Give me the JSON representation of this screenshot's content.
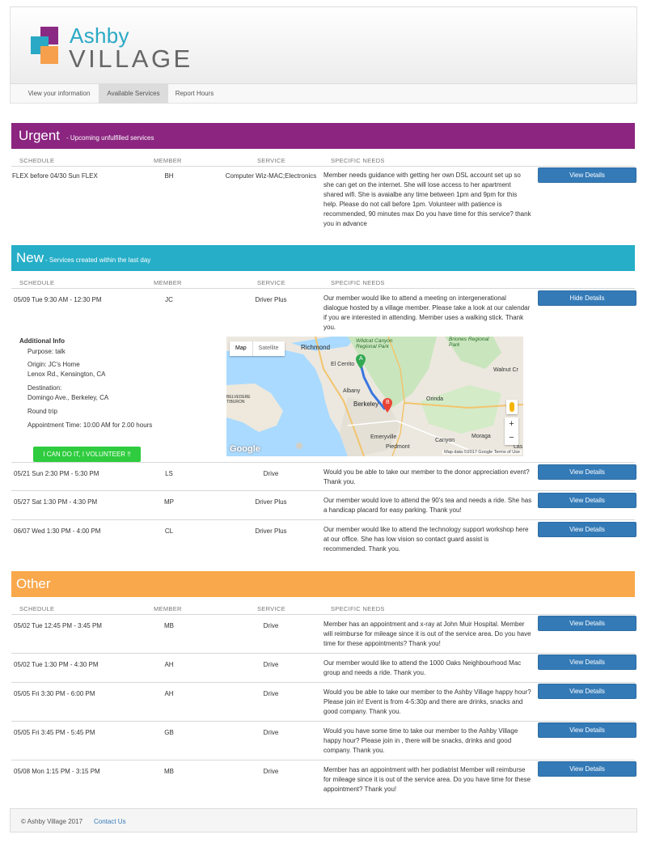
{
  "brand": {
    "line1": "Ashby",
    "line2": "VILLAGE"
  },
  "nav": {
    "tabs": [
      {
        "label": "View your information"
      },
      {
        "label": "Available Services"
      },
      {
        "label": "Report Hours"
      }
    ]
  },
  "columns": {
    "schedule": "SCHEDULE",
    "member": "MEMBER",
    "service": "SERVICE",
    "needs": "SPECIFIC NEEDS"
  },
  "urgent": {
    "title": "Urgent",
    "subtitle": " - Upcoming unfulfilled services",
    "rows": [
      {
        "schedule": "FLEX before 04/30 Sun  FLEX",
        "member": "BH",
        "service": "Computer Wiz-MAC;Electronics",
        "needs": "Member needs guidance with getting her own DSL account set up so she can get on the internet. She will lose access to her apartment shared wifi. She is avaialbe any time between 1pm and 9pm for this help. Please do not call before 1pm. Volunteer with patience is recommended, 90 minutes max Do you have time for this service? thank you in advance",
        "button": "View Details"
      }
    ]
  },
  "new": {
    "title": "New",
    "subtitle": " - Services created within the last day",
    "rows": [
      {
        "schedule": "05/09 Tue  9:30 AM - 12:30 PM",
        "member": "JC",
        "service": "Driver Plus",
        "needs": "Our member would like to attend a meeting on intergenerational dialogue hosted by a village member. Please take a look at our calendar if you are interested in attending. Member uses a walking stick. Thank you.",
        "button": "Hide Details"
      },
      {
        "schedule": "05/21 Sun  2:30 PM - 5:30 PM",
        "member": "LS",
        "service": "Drive",
        "needs": "Would you be able to take our member to the donor appreciation event? Thank you.",
        "button": "View Details"
      },
      {
        "schedule": "05/27 Sat  1:30 PM - 4:30 PM",
        "member": "MP",
        "service": "Driver Plus",
        "needs": "Our member would love to attend the 90's tea and needs a ride. She has a handicap placard for easy parking. Thank you!",
        "button": "View Details"
      },
      {
        "schedule": "06/07 Wed  1:30 PM - 4:00 PM",
        "member": "CL",
        "service": "Driver Plus",
        "needs": "Our member would like to attend the technology support workshop here at our office. She has low vision so contact guard assist is recommended. Thank you.",
        "button": "View Details"
      }
    ],
    "details": {
      "title": "Additional Info",
      "purpose": "Purpose: talk",
      "origin_label": "Origin: JC's Home",
      "origin_addr": "Lenox Rd., Kensington, CA",
      "dest_label": "Destination:",
      "dest_addr": "Domingo Ave., Berkeley, CA",
      "trip": "Round trip",
      "appt": "Appointment Time: 10:00 AM for 2.00 hours",
      "volunteer_button": "I CAN DO IT, I VOLUNTEER !!",
      "map": {
        "tab_map": "Map",
        "tab_satellite": "Satellite",
        "labels": {
          "richmond": "Richmond",
          "wildcat": "Wildcat Canyon Regional Park",
          "briones": "Briones Regional Park",
          "elcerrito": "El Cerrito",
          "walnut": "Walnut Cr",
          "albany": "Albany",
          "berkeley": "Berkeley",
          "orinda": "Orinda",
          "emeryville": "Emeryville",
          "piedmont": "Piedmont",
          "canyon": "Canyon",
          "moraga": "Moraga",
          "las": "Las",
          "belvedere": "BELVEDERE TIBURON"
        },
        "marker_a": "A",
        "marker_b": "B",
        "zoom_in": "+",
        "zoom_out": "−",
        "logo": "Google",
        "attribution": "Map data ©2017 Google   Terms of Use"
      }
    }
  },
  "other": {
    "title": "Other",
    "rows": [
      {
        "schedule": "05/02 Tue  12:45 PM - 3:45 PM",
        "member": "MB",
        "service": "Drive",
        "needs": "Member has an appointment and x-ray at John Muir Hospital. Member will reimburse for mileage since it is out of the service area. Do you have time for these appointments? Thank you!",
        "button": "View Details"
      },
      {
        "schedule": "05/02 Tue  1:30 PM - 4:30 PM",
        "member": "AH",
        "service": "Drive",
        "needs": "Our member would like to attend the 1000 Oaks Neighbourhood Mac group and needs a ride. Thank you.",
        "button": "View Details"
      },
      {
        "schedule": "05/05 Fri  3:30 PM - 6:00 PM",
        "member": "AH",
        "service": "Drive",
        "needs": "Would you be able to take our member to the Ashby Village happy hour? Please join in! Event is from 4-5:30p and there are drinks, snacks and good company. Thank you.",
        "button": "View Details"
      },
      {
        "schedule": "05/05 Fri  3:45 PM - 5:45 PM",
        "member": "GB",
        "service": "Drive",
        "needs": "Would you have some time to take our member to the Ashby Village happy hour? Please join in , there will be snacks, drinks and good company. Thank you.",
        "button": "View Details"
      },
      {
        "schedule": "05/08 Mon  1:15 PM - 3:15 PM",
        "member": "MB",
        "service": "Drive",
        "needs": "Member has an appointment with her podiatrist Member will reimburse for mileage since it is out of the service area. Do you have time for these appointment? Thank you!",
        "button": "View Details"
      }
    ]
  },
  "footer": {
    "copyright": "© Ashby Village 2017",
    "contact": "Contact Us"
  },
  "colors": {
    "urgent": "#8b2580",
    "new": "#26aec8",
    "other": "#f9a84c",
    "button": "#337ab7",
    "volunteer": "#2ecc3e"
  }
}
